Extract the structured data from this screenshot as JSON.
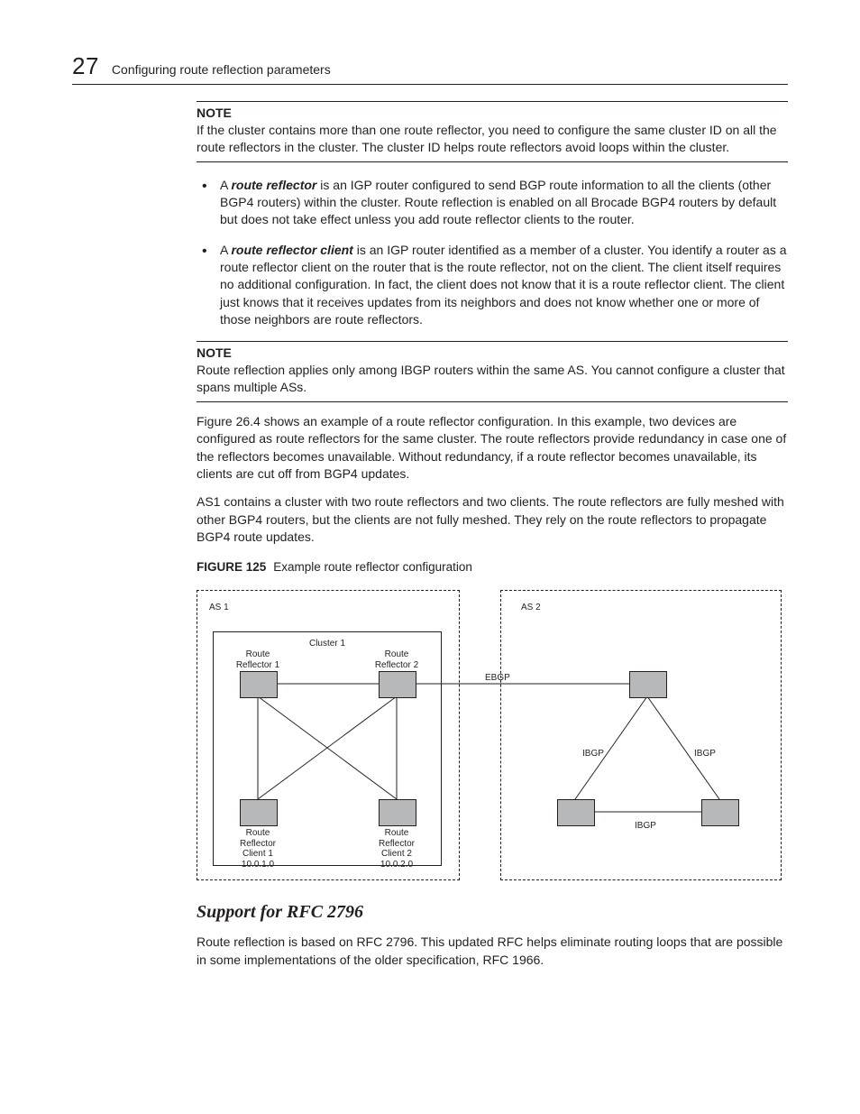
{
  "header": {
    "chapter_number": "27",
    "chapter_title": "Configuring route reflection parameters"
  },
  "note1": {
    "label": "NOTE",
    "body": "If the cluster contains more than one route reflector, you need to configure the same cluster ID on all the route reflectors in the cluster.  The cluster ID helps route reflectors avoid loops within the cluster."
  },
  "bullets": {
    "term1": "route reflector",
    "b1_pre": "A ",
    "b1_post": " is an IGP router configured to send BGP route information to all the clients (other BGP4 routers) within the cluster. Route reflection is enabled on all Brocade BGP4 routers by default but does not take effect unless you add route reflector clients to the router.",
    "term2": "route reflector client",
    "b2_pre": "A ",
    "b2_post": " is an IGP router identified as a member of a cluster.  You identify a router as a route reflector client on the router that is the route reflector, not on the client.  The client itself requires no additional configuration.  In fact, the client does not know that it is a route reflector client.  The client just knows that it receives updates from its neighbors and does not know whether one or more of those neighbors are route reflectors."
  },
  "note2": {
    "label": "NOTE",
    "body": "Route reflection applies only among IBGP routers within the same AS.  You cannot configure a cluster that spans multiple ASs."
  },
  "para1": "Figure 26.4 shows an example of a route reflector configuration. In this example, two devices are configured as route reflectors for the same cluster. The route reflectors provide redundancy in case one of the reflectors becomes unavailable. Without redundancy, if a route reflector becomes unavailable, its clients are cut off from BGP4 updates.",
  "para2": "AS1 contains a cluster with two route reflectors and two clients.  The route reflectors are fully meshed with other BGP4 routers, but the clients are not fully meshed.  They rely on the route reflectors to propagate BGP4 route updates.",
  "figure": {
    "num": "FIGURE 125",
    "title": "Example route reflector configuration"
  },
  "diagram": {
    "as1": "AS 1",
    "as2": "AS 2",
    "cluster": "Cluster 1",
    "rr1": "Route\nReflector 1",
    "rr2": "Route\nReflector 2",
    "rrc1": "Route\nReflector\nClient 1\n10.0.1.0",
    "rrc2": "Route\nReflector\nClient 2\n10.0.2.0",
    "ebgp": "EBGP",
    "ibgp": "IBGP"
  },
  "h2": "Support for RFC 2796",
  "para3": "Route reflection is based on RFC 2796.  This updated RFC helps eliminate routing loops that are possible in some implementations of the older specification, RFC 1966."
}
